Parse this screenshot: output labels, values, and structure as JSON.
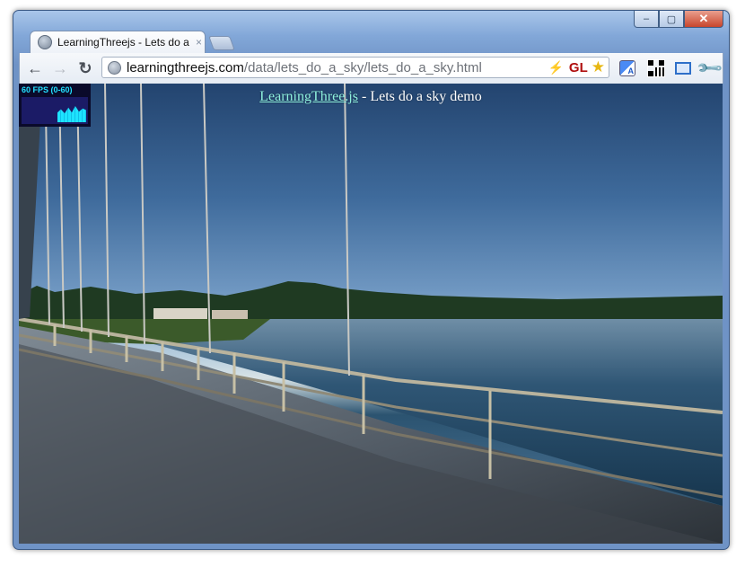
{
  "window": {
    "minimize_label": "–",
    "maximize_label": "▢",
    "close_label": "✕"
  },
  "tab": {
    "title": "LearningThreejs - Lets do a",
    "close_label": "×"
  },
  "toolbar": {
    "back_label": "←",
    "forward_label": "→",
    "reload_label": "↻"
  },
  "omnibox": {
    "url_host": "learningthreejs.com",
    "url_path": "/data/lets_do_a_sky/lets_do_a_sky.html",
    "bolt_glyph": "⚡",
    "gl_badge": "GL",
    "star_glyph": "★"
  },
  "extensions": {
    "translate_glyph": "A",
    "wrench_glyph": "🔧"
  },
  "page": {
    "demo_link": "LearningThree.js",
    "demo_title_rest": " - Lets do a sky demo",
    "fps_text": "60 FPS (0-60)"
  },
  "colors": {
    "link": "#8ef0dd",
    "fps_text": "#22e0ff",
    "gl_badge": "#b01010"
  }
}
